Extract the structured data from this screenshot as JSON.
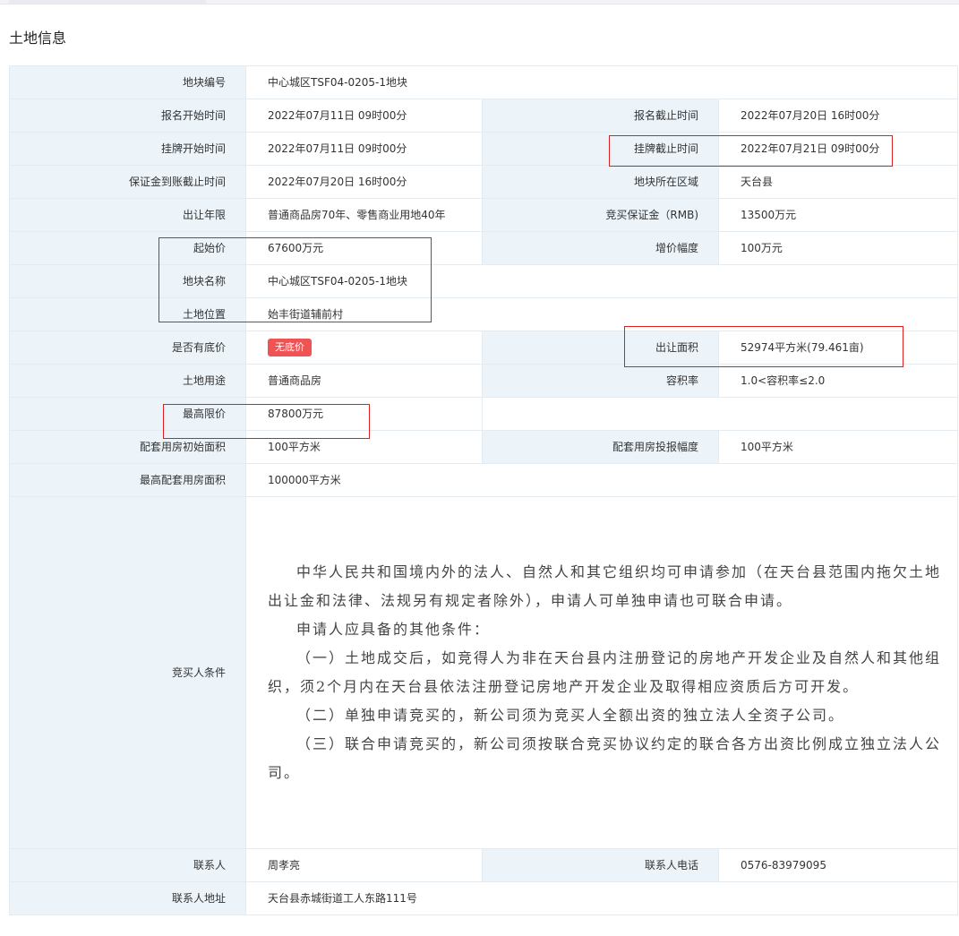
{
  "page": {
    "title": "土地信息"
  },
  "rows": {
    "parcel_no": {
      "label": "地块编号",
      "value": "中心城区TSF04-0205-1地块"
    },
    "reg_start": {
      "label": "报名开始时间",
      "value": "2022年07月11日 09时00分"
    },
    "reg_end": {
      "label": "报名截止时间",
      "value": "2022年07月20日 16时00分"
    },
    "list_start": {
      "label": "挂牌开始时间",
      "value": "2022年07月11日 09时00分"
    },
    "list_end": {
      "label": "挂牌截止时间",
      "value": "2022年07月21日 09时00分"
    },
    "deposit_deadline": {
      "label": "保证金到账截止时间",
      "value": "2022年07月20日 16时00分"
    },
    "district": {
      "label": "地块所在区域",
      "value": "天台县"
    },
    "term": {
      "label": "出让年限",
      "value": "普通商品房70年、零售商业用地40年"
    },
    "deposit": {
      "label": "竞买保证金（RMB)",
      "value": "13500万元"
    },
    "start_price": {
      "label": "起始价",
      "value": "67600万元"
    },
    "increment": {
      "label": "增价幅度",
      "value": "100万元"
    },
    "parcel_name": {
      "label": "地块名称",
      "value": "中心城区TSF04-0205-1地块"
    },
    "location": {
      "label": "土地位置",
      "value": "始丰街道辅前村"
    },
    "reserve": {
      "label": "是否有底价",
      "badge": "无底价"
    },
    "area": {
      "label": "出让面积",
      "value": "52974平方米(79.461亩)"
    },
    "use": {
      "label": "土地用途",
      "value": "普通商品房"
    },
    "far": {
      "label": "容积率",
      "value": "1.0<容积率≤2.0"
    },
    "max_price": {
      "label": "最高限价",
      "value": "87800万元"
    },
    "housing_init": {
      "label": "配套用房初始面积",
      "value": "100平方米"
    },
    "housing_step": {
      "label": "配套用房投报幅度",
      "value": "100平方米"
    },
    "housing_max": {
      "label": "最高配套用房面积",
      "value": "100000平方米"
    },
    "conditions": {
      "label": "竞买人条件",
      "paragraphs": [
        "中华人民共和国境内外的法人、自然人和其它组织均可申请参加（在天台县范围内拖欠土地出让金和法律、法规另有规定者除外），申请人可单独申请也可联合申请。",
        "申请人应具备的其他条件：",
        "（一）土地成交后，如竞得人为非在天台县内注册登记的房地产开发企业及自然人和其他组织，须2个月内在天台县依法注册登记房地产开发企业及取得相应资质后方可开发。",
        "（二）单独申请竞买的，新公司须为竞买人全额出资的独立法人全资子公司。",
        "（三）联合申请竞买的，新公司须按联合竞买协议约定的联合各方出资比例成立独立法人公司。"
      ]
    },
    "contact": {
      "label": "联系人",
      "value": "周孝亮"
    },
    "phone": {
      "label": "联系人电话",
      "value": "0576-83979095"
    },
    "address": {
      "label": "联系人地址",
      "value": "天台县赤城街道工人东路111号"
    }
  },
  "colors": {
    "label_bg": "#ecf4fa",
    "border": "#e4ebf1",
    "badge": "#ef5353",
    "highlight": "#e02020"
  }
}
